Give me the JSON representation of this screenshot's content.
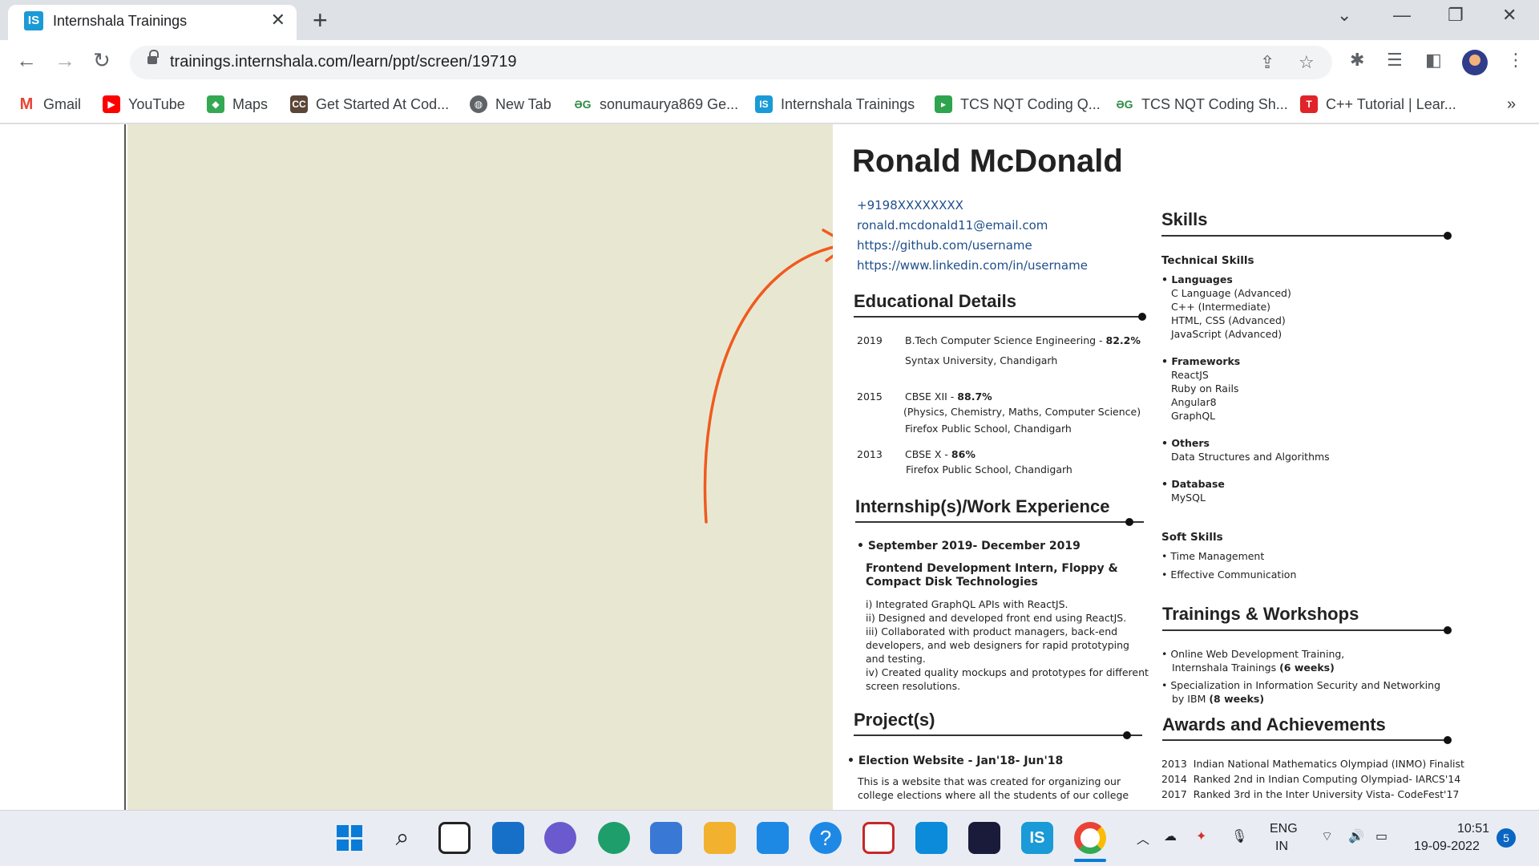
{
  "browser": {
    "tab_title": "Internshala Trainings",
    "tab_favicon": "IS",
    "url": "trainings.internshala.com/learn/ppt/screen/19719",
    "bookmarks": [
      {
        "label": "Gmail",
        "icon": "gmail-icon",
        "color": "#ea4335"
      },
      {
        "label": "YouTube",
        "icon": "youtube-icon",
        "color": "#ff0000"
      },
      {
        "label": "Maps",
        "icon": "maps-icon",
        "color": "#34a853"
      },
      {
        "label": "Get Started At Cod...",
        "icon": "codechef-icon",
        "color": "#5b4638"
      },
      {
        "label": "New Tab",
        "icon": "globe-icon",
        "color": "#5f6368"
      },
      {
        "label": "sonumaurya869 Ge...",
        "icon": "gfg-icon",
        "color": "#2f8d46"
      },
      {
        "label": "Internshala Trainings",
        "icon": "internshala-icon",
        "color": "#1a9ad6"
      },
      {
        "label": "TCS NQT Coding Q...",
        "icon": "shield-icon",
        "color": "#2ea44f"
      },
      {
        "label": "TCS NQT Coding Sh...",
        "icon": "gfg-icon",
        "color": "#2f8d46"
      },
      {
        "label": "C++ Tutorial | Lear...",
        "icon": "tutorial-icon",
        "color": "#e0242a"
      }
    ]
  },
  "resume": {
    "name": "Ronald McDonald",
    "contacts": [
      "+9198XXXXXXXX",
      "ronald.mcdonald11@email.com",
      "https://github.com/username",
      "https://www.linkedin.com/in/username"
    ],
    "education": {
      "title": "Educational Details",
      "entries": [
        {
          "year": "2019",
          "line1": "B.Tech Computer Science Engineering - ",
          "score": "82.2%",
          "line2": "Syntax University, Chandigarh"
        },
        {
          "year": "2015",
          "line1": "CBSE XII - ",
          "score": "88.7%",
          "line2": "(Physics, Chemistry, Maths, Computer Science)",
          "line3": "Firefox Public School, Chandigarh"
        },
        {
          "year": "2013",
          "line1": "CBSE X - ",
          "score": "86%",
          "line2": "Firefox Public School, Chandigarh"
        }
      ]
    },
    "experience": {
      "title": "Internship(s)/Work Experience",
      "period": "• September 2019- December 2019",
      "role_line1": "Frontend Development Intern, Floppy &",
      "role_line2": "Compact Disk Technologies",
      "points": [
        "i) Integrated GraphQL APIs with ReactJS.",
        "ii) Designed and developed front end using ReactJS.",
        "iii) Collaborated with product managers, back-end",
        "developers, and web designers for rapid prototyping",
        "and testing.",
        "iv) Created quality mockups and prototypes for different",
        "screen resolutions."
      ]
    },
    "projects": {
      "title": "Project(s)",
      "item": "• Election Website - Jan'18- Jun'18",
      "desc1": "This is a website that was created for organizing our",
      "desc2": "college elections where all the students of our college"
    },
    "skills": {
      "title": "Skills",
      "technical_title": "Technical Skills",
      "groups": [
        {
          "name": "• Languages",
          "items": [
            "C Language (Advanced)",
            "C++ (Intermediate)",
            "HTML, CSS (Advanced)",
            "JavaScript (Advanced)"
          ]
        },
        {
          "name": "• Frameworks",
          "items": [
            "ReactJS",
            "Ruby on Rails",
            "Angular8",
            "GraphQL"
          ]
        },
        {
          "name": "• Others",
          "items": [
            "Data Structures and Algorithms"
          ]
        },
        {
          "name": "• Database",
          "items": [
            "MySQL"
          ]
        }
      ],
      "soft_title": "Soft Skills",
      "soft": [
        "• Time Management",
        "• Effective Communication"
      ]
    },
    "trainings": {
      "title": "Trainings & Workshops",
      "t1_line1": "• Online Web Development Training,",
      "t1_line2": "Internshala Trainings ",
      "t1_bold": "(6 weeks)",
      "t2_line1": "• Specialization in Information Security and Networking",
      "t2_line2": "by IBM ",
      "t2_bold": "(8 weeks)"
    },
    "awards": {
      "title": "Awards and Achievements",
      "items": [
        {
          "year": "2013",
          "text": "Indian National Mathematics Olympiad (INMO) Finalist"
        },
        {
          "year": "2014",
          "text": "Ranked 2nd in Indian Computing Olympiad- IARCS'14"
        },
        {
          "year": "2017",
          "text": "Ranked 3rd in the Inter University Vista- CodeFest'17"
        }
      ]
    }
  },
  "taskbar": {
    "lang1": "ENG",
    "lang2": "IN",
    "time": "10:51",
    "date": "19-09-2022",
    "notifications": "5"
  }
}
